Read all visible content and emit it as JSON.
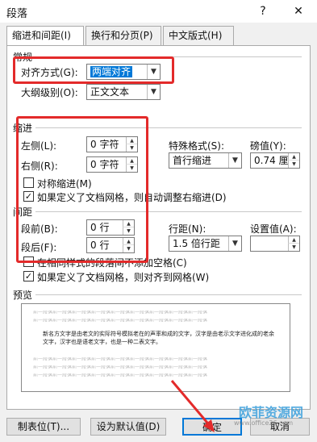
{
  "window": {
    "title": "段落",
    "help_label": "?",
    "close_label": "✕"
  },
  "tabs": [
    {
      "label": "缩进和间距(I)"
    },
    {
      "label": "换行和分页(P)"
    },
    {
      "label": "中文版式(H)"
    }
  ],
  "general": {
    "section_label": "常规",
    "alignment_label": "对齐方式(G):",
    "alignment_value": "两端对齐",
    "outline_label": "大纲级别(O):",
    "outline_value": "正文文本"
  },
  "indent": {
    "section_label": "缩进",
    "left_label": "左侧(L):",
    "left_value": "0 字符",
    "right_label": "右侧(R):",
    "right_value": "0 字符",
    "special_label": "特殊格式(S):",
    "special_value": "首行缩进",
    "by_label": "磅值(Y):",
    "by_value": "0.74 厘",
    "mirror_label": "对称缩进(M)",
    "auto_adjust_label": "如果定义了文档网格，则自动调整右缩进(D)"
  },
  "spacing": {
    "section_label": "间距",
    "before_label": "段前(B):",
    "before_value": "0 行",
    "after_label": "段后(F):",
    "after_value": "0 行",
    "line_spacing_label": "行距(N):",
    "line_spacing_value": "1.5 倍行距",
    "at_label": "设置值(A):",
    "at_value": "",
    "no_space_label": "在相同样式的段落间不添加空格(C)",
    "snap_grid_label": "如果定义了文档网格，则对齐到网格(W)"
  },
  "preview": {
    "section_label": "预览",
    "ghost_line": "前一段落前一段落前一段落前一段落前一段落前一段落前一段落前一段落前一段落",
    "sample_text": "新名方文字是由老文的实际符号模拟老在的声率和成的文字，汉字是由老示文字进化成的老余文字，汉字也是语老文字，也是一种二表文字。"
  },
  "buttons": {
    "tabs_label": "制表位(T)...",
    "default_label": "设为默认值(D)",
    "ok_label": "确定",
    "cancel_label": "取消"
  },
  "watermark": {
    "text": "欧菲资源网",
    "sub": "www.office26.com"
  },
  "colors": {
    "annotation": "#e32a2a",
    "accent": "#0078d7"
  }
}
